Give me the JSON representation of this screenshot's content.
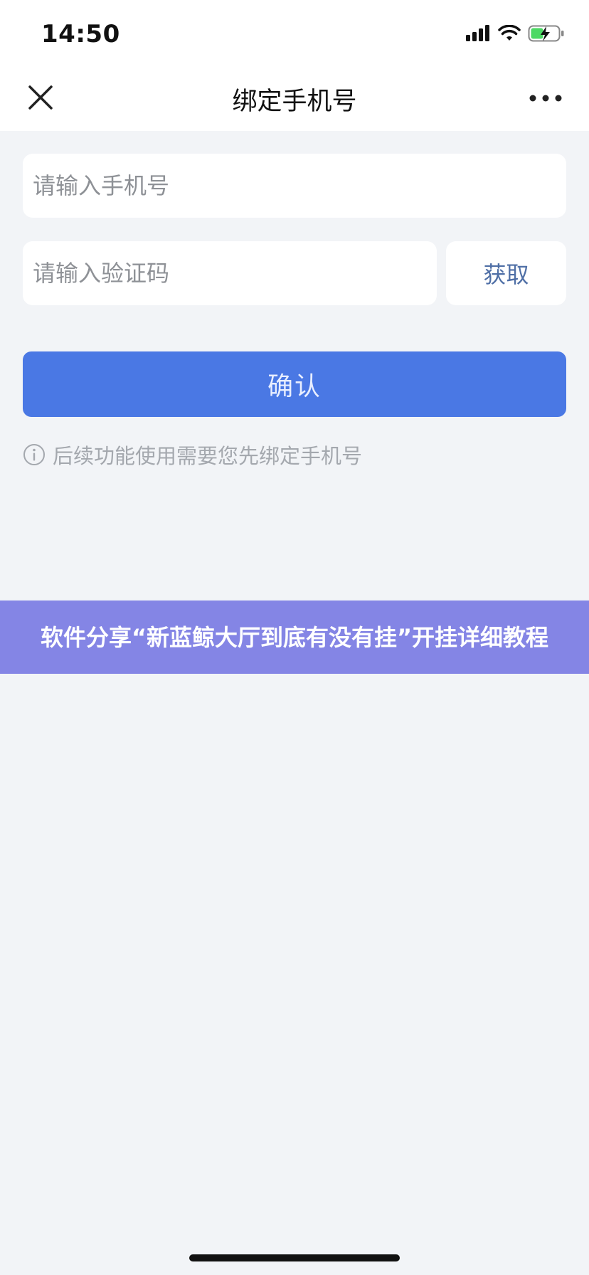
{
  "status_bar": {
    "time": "14:50",
    "icons": [
      "signal-icon",
      "wifi-icon",
      "battery-charging-icon"
    ],
    "battery_color": "#4cd964"
  },
  "nav": {
    "title": "绑定手机号",
    "left_icon": "close-icon",
    "right_icon": "more-icon"
  },
  "form": {
    "phone_placeholder": "请输入手机号",
    "phone_value": "",
    "code_placeholder": "请输入验证码",
    "code_value": "",
    "get_code_label": "获取",
    "confirm_label": "确认"
  },
  "hint": {
    "icon": "info-icon",
    "text": "后续功能使用需要您先绑定手机号"
  },
  "banner": {
    "text": "软件分享“新蓝鲸大厅到底有没有挂”开挂详细教程"
  },
  "colors": {
    "primary": "#4a78e4",
    "banner": "#8485e5",
    "background": "#f2f4f7",
    "link": "#4f6fa6"
  }
}
